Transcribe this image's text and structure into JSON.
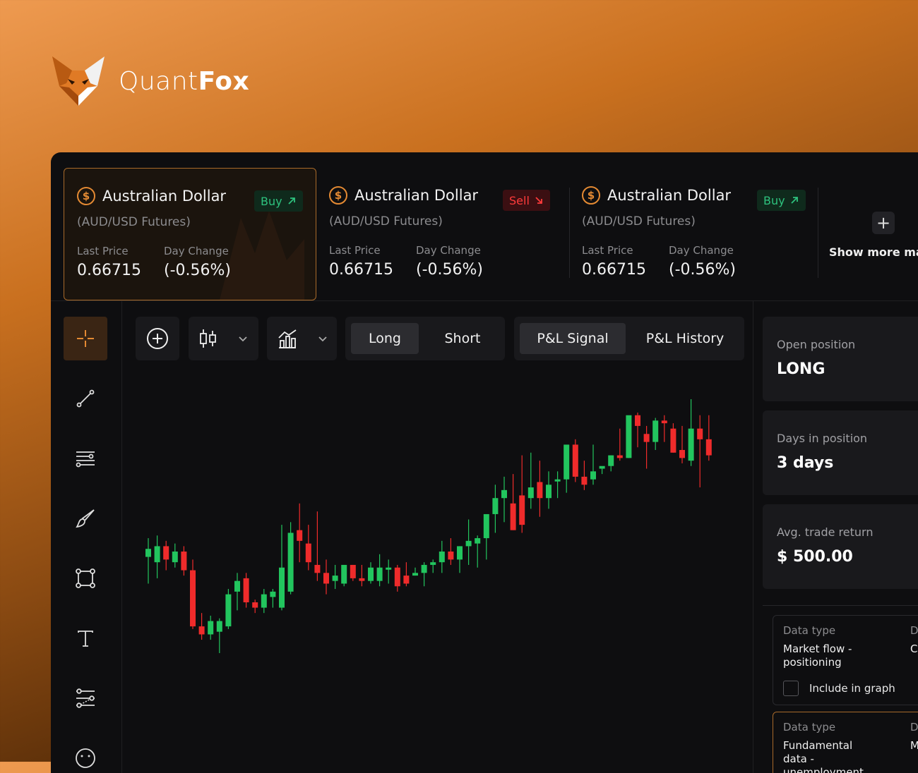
{
  "brand": {
    "name_light": "Quant",
    "name_bold": "Fox",
    "logo_icon": "fox-logo-icon",
    "accent": "#e48a33"
  },
  "tickers": [
    {
      "name": "Australian Dollar",
      "sub": "(AUD/USD Futures)",
      "signal": "Buy",
      "signal_icon": "arrow-up-right-icon",
      "last_price_label": "Last Price",
      "last_price": "0.66715",
      "day_change_label": "Day Change",
      "day_change": "(-0.56%)",
      "active": true
    },
    {
      "name": "Australian Dollar",
      "sub": "(AUD/USD Futures)",
      "signal": "Sell",
      "signal_icon": "arrow-down-right-icon",
      "last_price_label": "Last Price",
      "last_price": "0.66715",
      "day_change_label": "Day Change",
      "day_change": "(-0.56%)",
      "active": false
    },
    {
      "name": "Australian Dollar",
      "sub": "(AUD/USD Futures)",
      "signal": "Buy",
      "signal_icon": "arrow-up-right-icon",
      "last_price_label": "Last Price",
      "last_price": "0.66715",
      "day_change_label": "Day Change",
      "day_change": "(-0.56%)",
      "active": false
    }
  ],
  "show_more": "Show more mark",
  "tools": [
    "crosshair-icon",
    "trendline-icon",
    "horizontal-lines-icon",
    "brush-icon",
    "rectangle-icon",
    "text-icon",
    "pattern-icon",
    "emoji-icon"
  ],
  "toolbar": {
    "add_icon": "plus-circle-icon",
    "chart_type_icon": "candlestick-icon",
    "indicator_icon": "indicator-chart-icon",
    "long": "Long",
    "short": "Short",
    "pl_signal": "P&L Signal",
    "pl_history": "P&L History"
  },
  "stats": [
    {
      "label": "Open position",
      "value": "LONG"
    },
    {
      "label": "Days in position",
      "value": "3 days"
    },
    {
      "label": "Avg. trade return",
      "value": "$ 500.00"
    }
  ],
  "data_types": [
    {
      "label": "Data type",
      "value": "Market flow - positioning",
      "label2": "D",
      "value2": "C",
      "include_label": "Include in graph"
    },
    {
      "label": "Data type",
      "value": "Fundamental data - unemployment rate",
      "label2": "D",
      "value2": "M"
    }
  ],
  "colors": {
    "up": "#22c55e",
    "down": "#ef2b2b"
  },
  "chart_data": {
    "type": "candlestick",
    "candles": [
      {
        "o": 4.6,
        "h": 5.3,
        "l": 3.6,
        "c": 4.9
      },
      {
        "o": 4.4,
        "h": 5.4,
        "l": 3.8,
        "c": 5.0
      },
      {
        "o": 5.0,
        "h": 5.2,
        "l": 4.1,
        "c": 4.5
      },
      {
        "o": 4.4,
        "h": 5.1,
        "l": 4.2,
        "c": 4.8
      },
      {
        "o": 4.8,
        "h": 5.0,
        "l": 3.9,
        "c": 4.1
      },
      {
        "o": 4.1,
        "h": 4.5,
        "l": 1.9,
        "c": 2.0
      },
      {
        "o": 2.0,
        "h": 2.5,
        "l": 1.5,
        "c": 1.7
      },
      {
        "o": 1.7,
        "h": 2.4,
        "l": 1.5,
        "c": 2.2
      },
      {
        "o": 1.8,
        "h": 2.3,
        "l": 1.0,
        "c": 2.2
      },
      {
        "o": 2.0,
        "h": 3.4,
        "l": 1.9,
        "c": 3.2
      },
      {
        "o": 3.3,
        "h": 4.0,
        "l": 2.6,
        "c": 3.7
      },
      {
        "o": 3.8,
        "h": 4.0,
        "l": 2.7,
        "c": 2.9
      },
      {
        "o": 2.9,
        "h": 3.0,
        "l": 2.5,
        "c": 2.7
      },
      {
        "o": 2.7,
        "h": 3.4,
        "l": 2.5,
        "c": 3.2
      },
      {
        "o": 3.1,
        "h": 3.4,
        "l": 2.7,
        "c": 3.3
      },
      {
        "o": 2.7,
        "h": 5.8,
        "l": 2.6,
        "c": 4.2
      },
      {
        "o": 3.3,
        "h": 5.9,
        "l": 3.2,
        "c": 5.5
      },
      {
        "o": 5.6,
        "h": 6.6,
        "l": 4.4,
        "c": 5.2
      },
      {
        "o": 5.1,
        "h": 5.8,
        "l": 4.1,
        "c": 4.4
      },
      {
        "o": 4.3,
        "h": 6.3,
        "l": 3.7,
        "c": 4.0
      },
      {
        "o": 4.0,
        "h": 4.5,
        "l": 3.2,
        "c": 3.6
      },
      {
        "o": 3.7,
        "h": 4.3,
        "l": 3.4,
        "c": 3.9
      },
      {
        "o": 3.6,
        "h": 4.3,
        "l": 3.5,
        "c": 4.3
      },
      {
        "o": 4.3,
        "h": 4.3,
        "l": 3.7,
        "c": 3.8
      },
      {
        "o": 3.8,
        "h": 4.3,
        "l": 3.5,
        "c": 3.7
      },
      {
        "o": 3.7,
        "h": 4.4,
        "l": 3.6,
        "c": 4.2
      },
      {
        "o": 3.7,
        "h": 4.7,
        "l": 3.5,
        "c": 4.2
      },
      {
        "o": 4.2,
        "h": 4.5,
        "l": 3.6,
        "c": 4.2
      },
      {
        "o": 4.2,
        "h": 4.3,
        "l": 3.3,
        "c": 3.5
      },
      {
        "o": 3.9,
        "h": 4.4,
        "l": 3.5,
        "c": 3.6
      },
      {
        "o": 3.9,
        "h": 4.2,
        "l": 3.9,
        "c": 4.0
      },
      {
        "o": 4.0,
        "h": 4.4,
        "l": 3.5,
        "c": 4.3
      },
      {
        "o": 4.3,
        "h": 4.5,
        "l": 4.0,
        "c": 4.4
      },
      {
        "o": 4.4,
        "h": 5.2,
        "l": 4.0,
        "c": 4.8
      },
      {
        "o": 4.8,
        "h": 5.3,
        "l": 4.3,
        "c": 4.5
      },
      {
        "o": 4.5,
        "h": 5.0,
        "l": 4.0,
        "c": 5.0
      },
      {
        "o": 5.0,
        "h": 6.0,
        "l": 4.3,
        "c": 5.2
      },
      {
        "o": 5.1,
        "h": 5.4,
        "l": 4.2,
        "c": 5.3
      },
      {
        "o": 5.3,
        "h": 6.0,
        "l": 4.5,
        "c": 6.2
      },
      {
        "o": 6.2,
        "h": 7.3,
        "l": 5.5,
        "c": 6.8
      },
      {
        "o": 6.8,
        "h": 7.6,
        "l": 5.9,
        "c": 7.1
      },
      {
        "o": 6.6,
        "h": 7.7,
        "l": 5.6,
        "c": 5.6
      },
      {
        "o": 6.9,
        "h": 8.4,
        "l": 5.5,
        "c": 5.8
      },
      {
        "o": 6.8,
        "h": 8.5,
        "l": 6.4,
        "c": 7.2
      },
      {
        "o": 7.4,
        "h": 8.2,
        "l": 6.1,
        "c": 6.8
      },
      {
        "o": 6.8,
        "h": 7.8,
        "l": 6.4,
        "c": 7.3
      },
      {
        "o": 7.5,
        "h": 7.8,
        "l": 6.8,
        "c": 7.5
      },
      {
        "o": 7.5,
        "h": 8.1,
        "l": 7.0,
        "c": 8.8
      },
      {
        "o": 8.8,
        "h": 9.0,
        "l": 7.4,
        "c": 7.6
      },
      {
        "o": 7.6,
        "h": 8.2,
        "l": 7.1,
        "c": 7.3
      },
      {
        "o": 7.5,
        "h": 8.8,
        "l": 7.3,
        "c": 7.8
      },
      {
        "o": 7.9,
        "h": 7.9,
        "l": 7.7,
        "c": 8.0
      },
      {
        "o": 8.0,
        "h": 8.4,
        "l": 7.8,
        "c": 8.4
      },
      {
        "o": 8.4,
        "h": 9.4,
        "l": 8.2,
        "c": 8.3
      },
      {
        "o": 8.3,
        "h": 9.4,
        "l": 8.3,
        "c": 9.9
      },
      {
        "o": 9.9,
        "h": 10.0,
        "l": 8.7,
        "c": 9.5
      },
      {
        "o": 9.2,
        "h": 9.5,
        "l": 7.9,
        "c": 8.9
      },
      {
        "o": 8.9,
        "h": 9.8,
        "l": 8.6,
        "c": 9.7
      },
      {
        "o": 9.7,
        "h": 9.9,
        "l": 8.9,
        "c": 9.6
      },
      {
        "o": 9.4,
        "h": 9.6,
        "l": 8.5,
        "c": 8.5
      },
      {
        "o": 8.6,
        "h": 9.5,
        "l": 8.1,
        "c": 8.3
      },
      {
        "o": 8.2,
        "h": 10.5,
        "l": 8.0,
        "c": 9.4
      },
      {
        "o": 9.4,
        "h": 9.9,
        "l": 7.2,
        "c": 9.0
      },
      {
        "o": 9.0,
        "h": 9.9,
        "l": 8.2,
        "c": 8.4
      }
    ]
  }
}
